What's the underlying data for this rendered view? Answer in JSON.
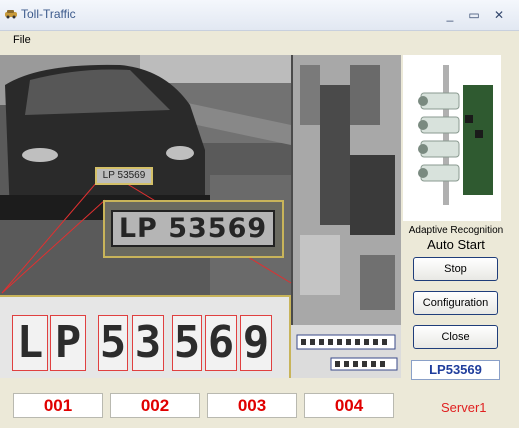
{
  "window": {
    "title": "Toll-Traffic",
    "minimize_glyph": "_",
    "maximize_glyph": "▭",
    "close_glyph": "✕"
  },
  "menu": {
    "file": "File"
  },
  "video": {
    "small_plate": "LP 53569",
    "zoom_plate": "LP 53569",
    "characters": [
      "L",
      "P",
      "5",
      "3",
      "5",
      "6",
      "9"
    ]
  },
  "side": {
    "adaptive": "Adaptive Recognition",
    "autostart": "Auto Start",
    "stop": "Stop",
    "configuration": "Configuration",
    "close": "Close",
    "plate_result": "LP53569"
  },
  "lanes": [
    "001",
    "002",
    "003",
    "004"
  ],
  "server": "Server1",
  "colors": {
    "lane_text": "#e00000",
    "plate_result": "#1f3d9c",
    "server": "#e02020"
  }
}
